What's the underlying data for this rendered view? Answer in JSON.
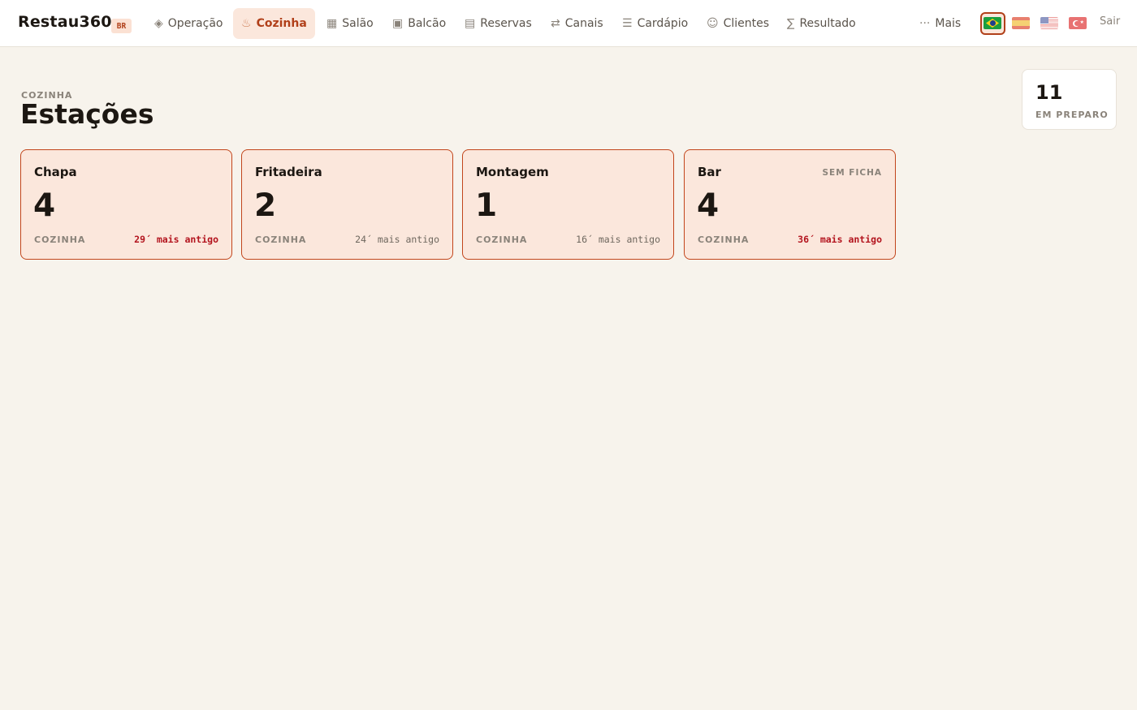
{
  "brand": {
    "name": "Restau360",
    "badge": "BR"
  },
  "nav": [
    {
      "icon": "◈",
      "icon_name": "diamond-icon",
      "label": "Operação",
      "active": false
    },
    {
      "icon": "♨",
      "icon_name": "hot-springs-icon",
      "label": "Cozinha",
      "active": true
    },
    {
      "icon": "▦",
      "icon_name": "grid-icon",
      "label": "Salão",
      "active": false
    },
    {
      "icon": "▣",
      "icon_name": "square-icon",
      "label": "Balcão",
      "active": false
    },
    {
      "icon": "▤",
      "icon_name": "list-box-icon",
      "label": "Reservas",
      "active": false
    },
    {
      "icon": "⇄",
      "icon_name": "swap-arrows-icon",
      "label": "Canais",
      "active": false
    },
    {
      "icon": "☰",
      "icon_name": "menu-lines-icon",
      "label": "Cardápio",
      "active": false
    },
    {
      "icon": "☺",
      "icon_name": "smiley-icon",
      "label": "Clientes",
      "active": false
    },
    {
      "icon": "∑",
      "icon_name": "sigma-icon",
      "label": "Resultado",
      "active": false
    },
    {
      "icon": "···",
      "icon_name": "more-dots-icon",
      "label": "Mais",
      "active": false
    }
  ],
  "languages": {
    "selected": "br",
    "flags": [
      "br-flag-icon",
      "es-flag-icon",
      "us-flag-icon",
      "tr-flag-icon"
    ]
  },
  "logout_label": "Sair",
  "header": {
    "eyebrow": "COZINHA",
    "title": "Estações"
  },
  "stat": {
    "value": "11",
    "label": "EM PREPARO"
  },
  "stations": [
    {
      "name": "Chapa",
      "count": "4",
      "area": "COZINHA",
      "age": "29´ mais antigo",
      "late": true,
      "flag": ""
    },
    {
      "name": "Fritadeira",
      "count": "2",
      "area": "COZINHA",
      "age": "24´ mais antigo",
      "late": false,
      "flag": ""
    },
    {
      "name": "Montagem",
      "count": "1",
      "area": "COZINHA",
      "age": "16´ mais antigo",
      "late": false,
      "flag": ""
    },
    {
      "name": "Bar",
      "count": "4",
      "area": "COZINHA",
      "age": "36´ mais antigo",
      "late": true,
      "flag": "SEM FICHA"
    }
  ],
  "colors": {
    "accent": "#b1401a",
    "card_bg": "#fbe7dc",
    "card_border": "#c2461c",
    "late_text": "#b3141e",
    "page_bg": "#f7f3ec"
  }
}
